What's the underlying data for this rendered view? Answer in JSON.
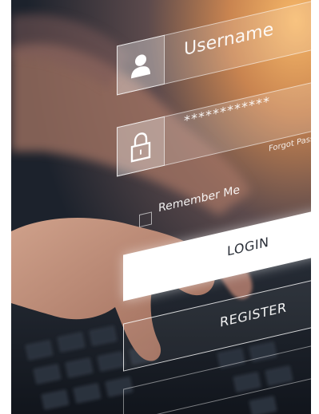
{
  "login_form": {
    "username_label": "Username",
    "password_masked": "************",
    "forgot_password_label": "Forgot Passw",
    "remember_me_label": "Remember Me",
    "login_label": "LOGIN",
    "register_label": "REGISTER"
  },
  "icons": {
    "username": "user-icon",
    "password": "padlock-icon"
  },
  "colors": {
    "glow": "#f0a050",
    "dark": "#1e2530",
    "button": "#ffffff"
  }
}
